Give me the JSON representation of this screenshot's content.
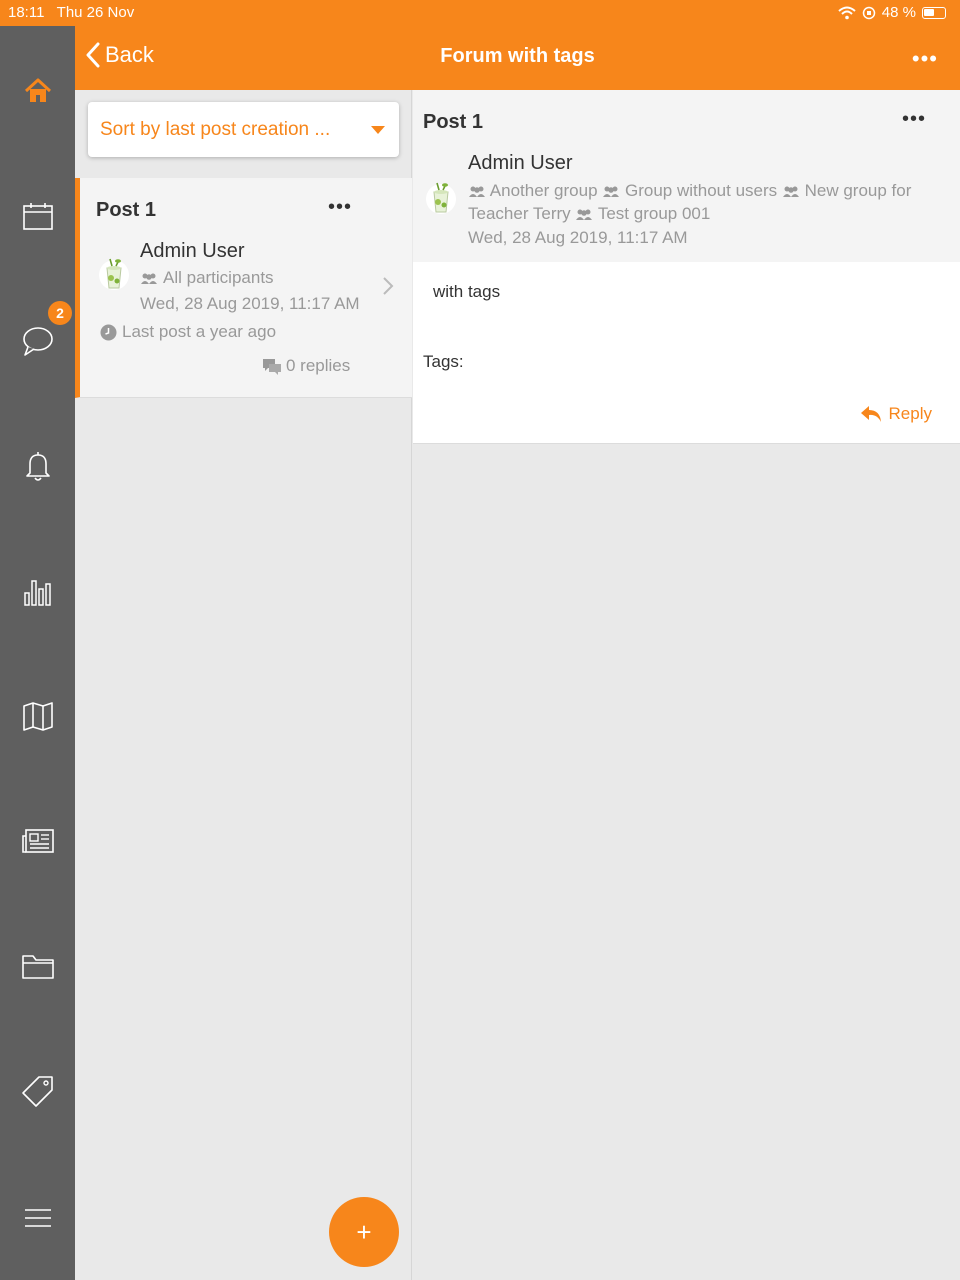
{
  "status_bar": {
    "time": "18:11",
    "date": "Thu 26 Nov",
    "battery": "48 %"
  },
  "sidebar": {
    "items": [
      {
        "icon": "home-icon",
        "active": true
      },
      {
        "icon": "calendar-icon"
      },
      {
        "icon": "chat-icon",
        "badge": "2"
      },
      {
        "icon": "bell-icon"
      },
      {
        "icon": "bar-chart-icon"
      },
      {
        "icon": "map-icon"
      },
      {
        "icon": "newspaper-icon"
      },
      {
        "icon": "folder-icon"
      },
      {
        "icon": "tag-icon"
      },
      {
        "icon": "menu-icon"
      }
    ]
  },
  "header": {
    "back_label": "Back",
    "title": "Forum with tags",
    "more": "•••"
  },
  "list": {
    "sort_label": "Sort by last post creation ...",
    "posts": [
      {
        "title": "Post 1",
        "more": "•••",
        "author": "Admin User",
        "groups": "All participants",
        "date": "Wed, 28 Aug 2019, 11:17 AM",
        "last_post": "Last post a year ago",
        "replies": "0 replies"
      }
    ],
    "fab_label": "+"
  },
  "detail": {
    "title": "Post 1",
    "more": "•••",
    "author": "Admin User",
    "groups": [
      "Another group",
      "Group without users",
      "New group for Teacher Terry",
      "Test group 001"
    ],
    "date": "Wed, 28 Aug 2019, 11:17 AM",
    "content": "with tags",
    "tags_label": "Tags:",
    "reply_label": "Reply"
  },
  "colors": {
    "accent": "#f7861b",
    "sidebar": "#5f5f5f",
    "muted_text": "#999999"
  }
}
